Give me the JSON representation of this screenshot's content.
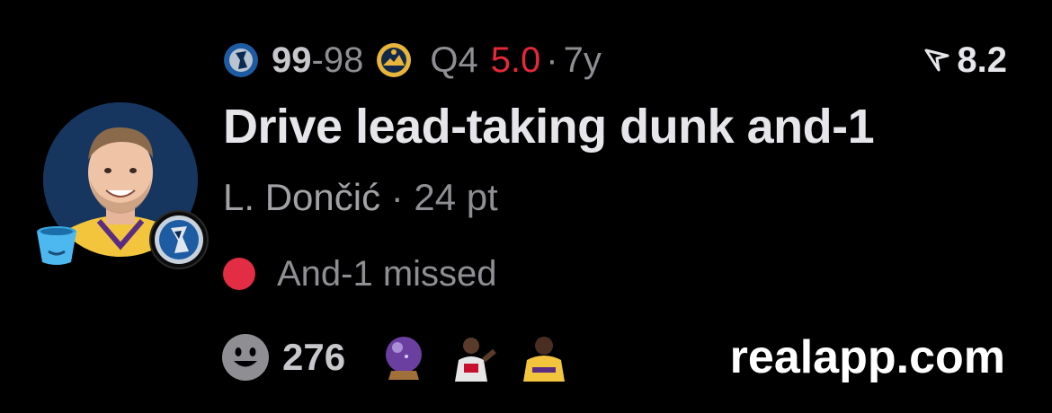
{
  "header": {
    "home_score": "99",
    "separator": "-",
    "away_score": "98",
    "quarter": "Q4",
    "clock": "5.0",
    "dot": "·",
    "age": "7y",
    "rating": "8.2",
    "home_team_icon": "mavericks-logo",
    "away_team_icon": "nuggets-logo",
    "rating_icon": "rating-arrow-icon"
  },
  "play": {
    "title": "Drive lead-taking dunk and-1",
    "player": "L. Dončić",
    "dot": "·",
    "points": "24 pt",
    "status": "And-1 missed",
    "status_color": "#e22d44"
  },
  "footer": {
    "reaction_count": "276",
    "reaction_icon": "smiley-icon",
    "extra_icons": [
      "crystal-ball-icon",
      "player-thumb-icon",
      "player-thumb-icon"
    ],
    "brand": "realapp.com"
  },
  "colors": {
    "background": "#000000",
    "muted": "#8e8e93",
    "strong": "#e5e5ea",
    "accent_red": "#e5283a",
    "mavericks_blue": "#1f5fa8"
  }
}
